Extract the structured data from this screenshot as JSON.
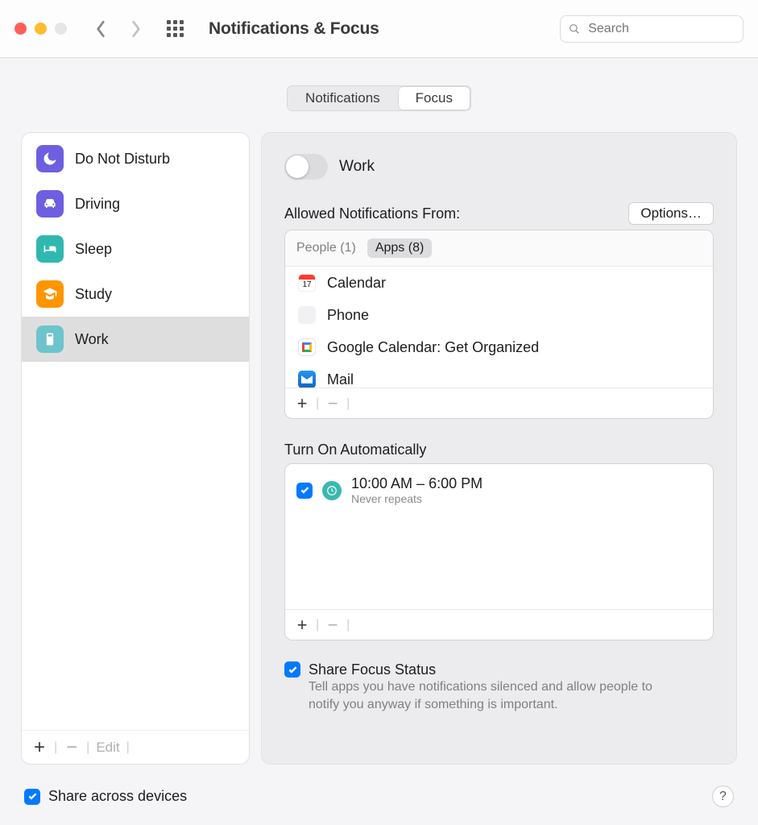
{
  "titlebar": {
    "title": "Notifications & Focus",
    "search_placeholder": "Search"
  },
  "tabs": {
    "notifications": "Notifications",
    "focus": "Focus",
    "active": "focus"
  },
  "sidebar": {
    "items": [
      {
        "label": "Do Not Disturb",
        "color": "#6d5fe0",
        "icon": "moon"
      },
      {
        "label": "Driving",
        "color": "#6d5fe0",
        "icon": "car"
      },
      {
        "label": "Sleep",
        "color": "#2fb8b0",
        "icon": "bed"
      },
      {
        "label": "Study",
        "color": "#ff9500",
        "icon": "grad"
      },
      {
        "label": "Work",
        "color": "#6dc4cc",
        "icon": "badge",
        "selected": true
      }
    ],
    "footer": {
      "add": "+",
      "remove": "−",
      "edit": "Edit"
    }
  },
  "detail": {
    "focus_name": "Work",
    "toggle_on": false,
    "allowed_label": "Allowed Notifications From:",
    "options_button": "Options…",
    "people_tab": "People (1)",
    "apps_tab": "Apps (8)",
    "apps": [
      {
        "label": "Calendar",
        "icon": "calendar"
      },
      {
        "label": "Phone",
        "icon": "phone"
      },
      {
        "label": "Google Calendar: Get Organized",
        "icon": "gcal"
      },
      {
        "label": "Mail",
        "icon": "mail"
      }
    ],
    "auto_label": "Turn On Automatically",
    "schedules": [
      {
        "enabled": true,
        "time": "10:00 AM – 6:00 PM",
        "repeat": "Never repeats"
      }
    ],
    "share_focus": {
      "checked": true,
      "title": "Share Focus Status",
      "desc": "Tell apps you have notifications silenced and allow people to notify you anyway if something is important."
    }
  },
  "bottom": {
    "share_devices_checked": true,
    "share_devices_label": "Share across devices"
  }
}
